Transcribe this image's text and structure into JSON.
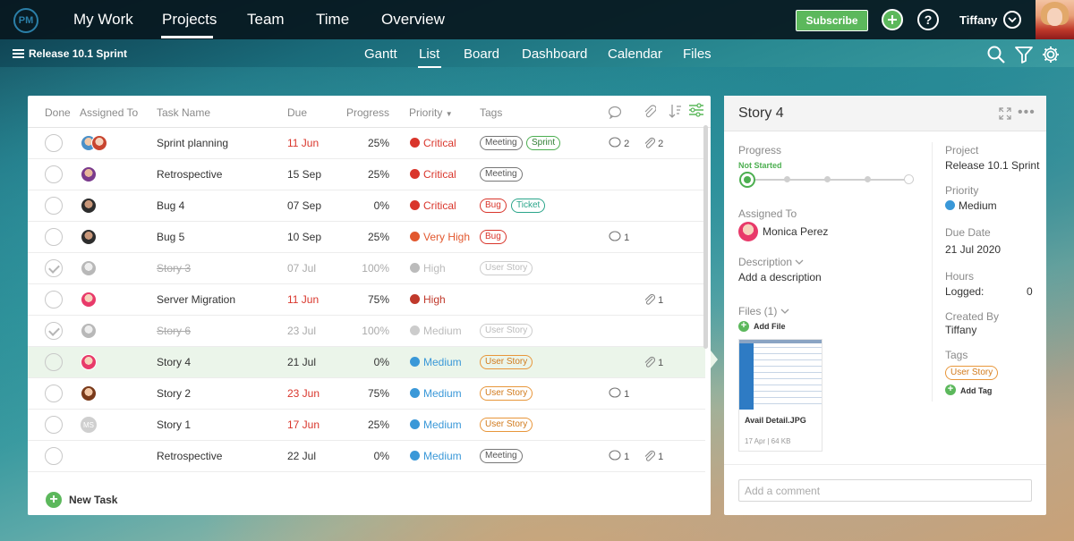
{
  "topnav": {
    "logo": "PM",
    "items": [
      "My Work",
      "Projects",
      "Team",
      "Time",
      "Overview"
    ],
    "subscribe": "Subscribe",
    "user": "Tiffany"
  },
  "subnav": {
    "project": "Release 10.1 Sprint",
    "tabs": [
      "Gantt",
      "List",
      "Board",
      "Dashboard",
      "Calendar",
      "Files"
    ],
    "active_tab": "List"
  },
  "list": {
    "columns": {
      "done": "Done",
      "assigned": "Assigned To",
      "task": "Task Name",
      "due": "Due",
      "progress": "Progress",
      "priority": "Priority",
      "tags": "Tags"
    },
    "rows": [
      {
        "task": "Sprint planning",
        "due": "11 Jun",
        "progress": "25%",
        "priority": "Critical",
        "tags": [
          "Meeting",
          "Sprint"
        ],
        "comments": "2",
        "attachments": "2"
      },
      {
        "task": "Retrospective",
        "due": "15 Sep",
        "progress": "25%",
        "priority": "Critical",
        "tags": [
          "Meeting"
        ],
        "comments": "",
        "attachments": ""
      },
      {
        "task": "Bug 4",
        "due": "07 Sep",
        "progress": "0%",
        "priority": "Critical",
        "tags": [
          "Bug",
          "Ticket"
        ],
        "comments": "",
        "attachments": ""
      },
      {
        "task": "Bug 5",
        "due": "10 Sep",
        "progress": "25%",
        "priority": "Very High",
        "tags": [
          "Bug"
        ],
        "comments": "1",
        "attachments": ""
      },
      {
        "task": "Story 3",
        "due": "07 Jul",
        "progress": "100%",
        "priority": "High",
        "tags": [
          "User Story"
        ],
        "comments": "",
        "attachments": ""
      },
      {
        "task": "Server Migration",
        "due": "11 Jun",
        "progress": "75%",
        "priority": "High",
        "tags": [],
        "comments": "",
        "attachments": "1"
      },
      {
        "task": "Story 6",
        "due": "23 Jul",
        "progress": "100%",
        "priority": "Medium",
        "tags": [
          "User Story"
        ],
        "comments": "",
        "attachments": ""
      },
      {
        "task": "Story 4",
        "due": "21 Jul",
        "progress": "0%",
        "priority": "Medium",
        "tags": [
          "User Story"
        ],
        "comments": "",
        "attachments": "1"
      },
      {
        "task": "Story 2",
        "due": "23 Jun",
        "progress": "75%",
        "priority": "Medium",
        "tags": [
          "User Story"
        ],
        "comments": "1",
        "attachments": ""
      },
      {
        "task": "Story 1",
        "due": "17 Jun",
        "progress": "25%",
        "priority": "Medium",
        "tags": [
          "User Story"
        ],
        "comments": "",
        "attachments": "",
        "initials": "MS"
      },
      {
        "task": "Retrospective",
        "due": "22 Jul",
        "progress": "0%",
        "priority": "Medium",
        "tags": [
          "Meeting"
        ],
        "comments": "1",
        "attachments": "1"
      }
    ],
    "new_task": "New Task"
  },
  "detail": {
    "title": "Story 4",
    "progress_label": "Progress",
    "progress_status": "Not Started",
    "assigned_label": "Assigned To",
    "assignee": "Monica Perez",
    "description_label": "Description",
    "description_placeholder": "Add a description",
    "files_label": "Files (1)",
    "add_file": "Add File",
    "file_name": "Avail Detail.JPG",
    "file_meta": "17 Apr | 64 KB",
    "project_label": "Project",
    "project_value": "Release 10.1 Sprint",
    "priority_label": "Priority",
    "priority_value": "Medium",
    "due_label": "Due Date",
    "due_value": "21 Jul 2020",
    "hours_label": "Hours",
    "logged_label": "Logged:",
    "logged_value": "0",
    "created_label": "Created By",
    "created_value": "Tiffany",
    "tags_label": "Tags",
    "tag_value": "User Story",
    "add_tag": "Add Tag",
    "comment_placeholder": "Add a comment"
  },
  "colors": {
    "critical": "#d9352b",
    "very_high": "#e2582f",
    "high": "#c0392b",
    "medium": "#3a98d8",
    "brand_green": "#5cb85c"
  }
}
